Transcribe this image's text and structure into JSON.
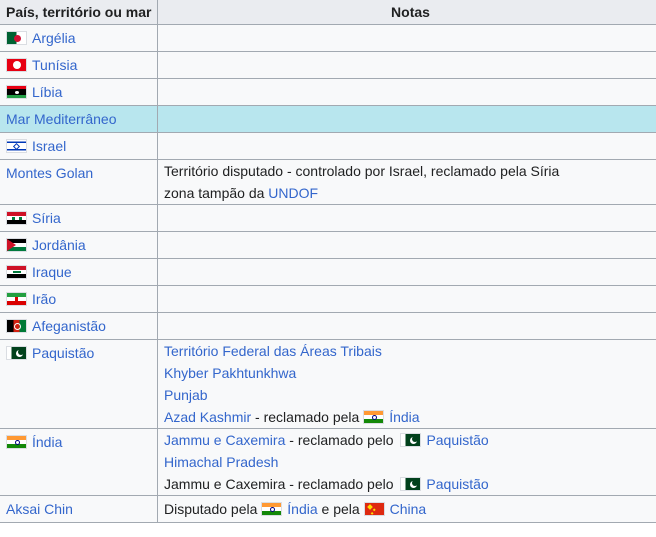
{
  "headers": {
    "country": "País, território ou mar",
    "notes": "Notas"
  },
  "rows": {
    "algeria": {
      "name": "Argélia",
      "flag": "algeria-flag-icon"
    },
    "tunisia": {
      "name": "Tunísia",
      "flag": "tunisia-flag-icon"
    },
    "libya": {
      "name": "Líbia",
      "flag": "libya-flag-icon"
    },
    "mediterranean": {
      "name": "Mar Mediterrâneo",
      "bg": "#b8e6ee"
    },
    "israel": {
      "name": "Israel",
      "flag": "israel-flag-icon"
    },
    "golan": {
      "name": "Montes Golan",
      "note_line1": "Território disputado - controlado por Israel, reclamado pela Síria",
      "note_line2_prefix": "zona tampão da",
      "note_line2_link": "UNDOF"
    },
    "syria": {
      "name": "Síria",
      "flag": "syria-flag-icon"
    },
    "jordan": {
      "name": "Jordânia",
      "flag": "jordan-flag-icon"
    },
    "iraq": {
      "name": "Iraque",
      "flag": "iraq-flag-icon"
    },
    "iran": {
      "name": "Irão",
      "flag": "iran-flag-icon"
    },
    "afghanistan": {
      "name": "Afeganistão",
      "flag": "afghanistan-flag-icon"
    },
    "pakistan": {
      "name": "Paquistão",
      "flag": "pakistan-flag-icon",
      "note1": "Território Federal das Áreas Tribais",
      "note2": "Khyber Pakhtunkhwa",
      "note3": "Punjab",
      "note4_link": "Azad Kashmir",
      "note4_text": " - reclamado pela ",
      "note4_country": "Índia"
    },
    "india": {
      "name": "Índia",
      "flag": "india-flag-icon",
      "note1_link": "Jammu e Caxemira",
      "note1_text": " - reclamado pelo ",
      "note1_country": "Paquistão",
      "note2": "Himachal Pradesh",
      "note3_text": "Jammu e Caxemira - reclamado pelo ",
      "note3_country": "Paquistão"
    },
    "aksai": {
      "name": "Aksai Chin",
      "note_prefix": "Disputado pela ",
      "note_country1": "Índia",
      "note_mid": " e pela ",
      "note_country2": "China"
    }
  },
  "colors": {
    "link": "#3366cc",
    "border": "#a2a9b1",
    "header_bg": "#eaecf0",
    "row_bg": "#f8f9fa",
    "sea_bg": "#b8e6ee"
  }
}
